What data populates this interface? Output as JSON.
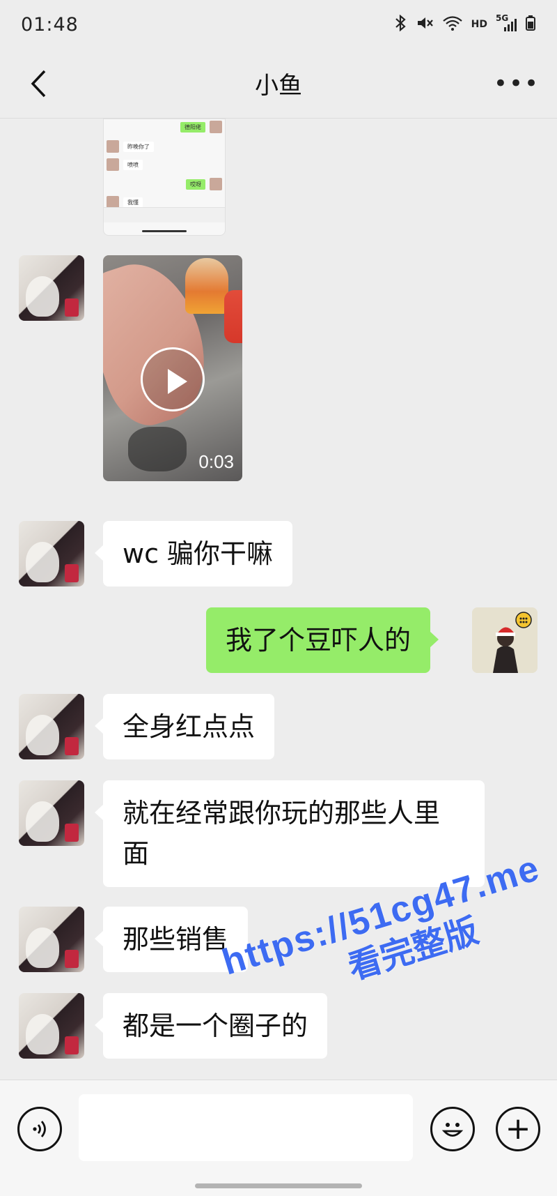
{
  "status_bar": {
    "time": "01:48",
    "icons": [
      "bluetooth-icon",
      "mute-icon",
      "wifi-icon",
      "hd-icon",
      "signal-5g-icon",
      "battery-icon"
    ],
    "hd_label": "HD",
    "network_label": "5G"
  },
  "header": {
    "title": "小鱼",
    "back_icon": "chevron-left-icon",
    "more_label": "•••"
  },
  "screenshot_preview": {
    "rows": [
      {
        "side": "right",
        "text": "德阳佬"
      },
      {
        "side": "left",
        "text": "昨晚你了"
      },
      {
        "side": "left",
        "text": "喷喷"
      },
      {
        "side": "right",
        "text": "哎呀"
      },
      {
        "side": "left",
        "text": "我懂"
      }
    ]
  },
  "video_message": {
    "duration": "0:03",
    "play_icon": "play-icon"
  },
  "messages": [
    {
      "side": "left",
      "text": "wc 骗你干嘛"
    },
    {
      "side": "right",
      "text": "我了个豆吓人的"
    },
    {
      "side": "left",
      "text": "全身红点点"
    },
    {
      "side": "left",
      "line1": "就在经常跟你玩的那些人里",
      "line2": "面"
    },
    {
      "side": "left",
      "text": "那些销售"
    },
    {
      "side": "left",
      "text": "都是一个圈子的"
    }
  ],
  "watermark": {
    "line1": "https://51cg47.me",
    "line2": "看完整版"
  },
  "input_bar": {
    "placeholder": "",
    "voice_icon": "voice-icon",
    "emoji_icon": "emoji-icon",
    "plus_label": "+"
  },
  "colors": {
    "background": "#ededed",
    "sent_bubble": "#95ec69",
    "received_bubble": "#ffffff",
    "watermark": "#3d6bf2"
  }
}
